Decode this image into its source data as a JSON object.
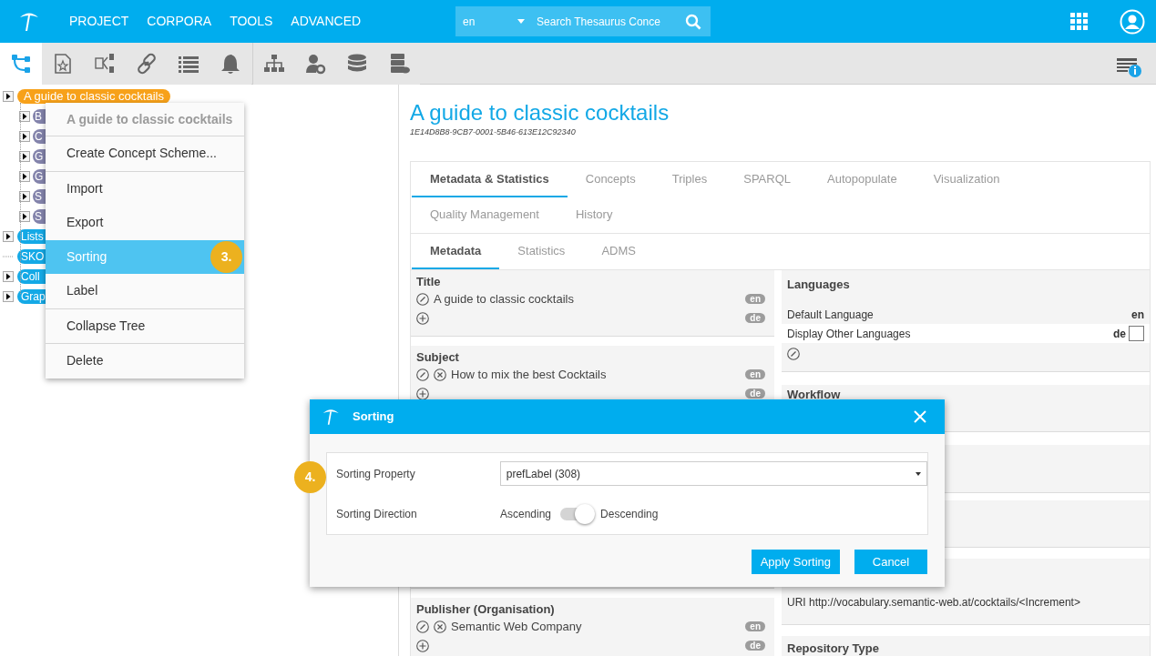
{
  "header": {
    "nav": [
      "PROJECT",
      "CORPORA",
      "TOOLS",
      "ADVANCED"
    ],
    "search": {
      "language": "en",
      "placeholder": "Search Thesaurus Conce"
    }
  },
  "toolbar": {
    "tools": [
      {
        "selected": true
      },
      {
        "selected": false
      },
      {
        "selected": false
      },
      {
        "selected": false
      },
      {
        "selected": false
      },
      {
        "selected": false
      },
      {
        "selected": false
      },
      {
        "selected": false
      },
      {
        "selected": false
      },
      {
        "selected": false
      }
    ]
  },
  "tree": [
    {
      "label": "A guide to classic cocktails",
      "kind": "scheme",
      "expandable": true,
      "children": [
        {
          "label": "B",
          "kind": "concept",
          "expandable": true
        },
        {
          "label": "C",
          "kind": "concept",
          "expandable": true
        },
        {
          "label": "G",
          "kind": "concept",
          "expandable": true
        },
        {
          "label": "G",
          "kind": "concept",
          "expandable": true
        },
        {
          "label": "S",
          "kind": "concept",
          "expandable": true
        },
        {
          "label": "S",
          "kind": "concept",
          "expandable": true
        }
      ]
    },
    {
      "label": "Lists",
      "kind": "folder",
      "expandable": true
    },
    {
      "label": "SKO",
      "kind": "folder",
      "expandable": false
    },
    {
      "label": "Coll",
      "kind": "folder",
      "expandable": true
    },
    {
      "label": "Grap",
      "kind": "folder",
      "expandable": true
    }
  ],
  "context_menu": {
    "title": "A guide to classic cocktails",
    "step_badge": "3.",
    "groups": [
      [
        {
          "label": "Create Concept Scheme...",
          "selected": false
        }
      ],
      [
        {
          "label": "Import",
          "selected": false
        },
        {
          "label": "Export",
          "selected": false
        },
        {
          "label": "Sorting",
          "selected": true
        },
        {
          "label": "Label",
          "selected": false
        }
      ],
      [
        {
          "label": "Collapse Tree",
          "selected": false
        }
      ],
      [
        {
          "label": "Delete",
          "selected": false
        }
      ]
    ]
  },
  "scheme": {
    "title": "A guide to classic cocktails",
    "id": "1E14D8B8-9CB7-0001-5B46-613E12C92340",
    "tabs": [
      [
        {
          "label": "Metadata & Statistics",
          "selected": true
        },
        {
          "label": "Concepts",
          "selected": false
        },
        {
          "label": "Triples",
          "selected": false
        },
        {
          "label": "SPARQL",
          "selected": false
        },
        {
          "label": "Autopopulate",
          "selected": false
        },
        {
          "label": "Visualization",
          "selected": false
        }
      ],
      [
        {
          "label": "Quality Management",
          "selected": false
        },
        {
          "label": "History",
          "selected": false
        }
      ]
    ],
    "subtabs": [
      {
        "label": "Metadata",
        "selected": true
      },
      {
        "label": "Statistics",
        "selected": false
      },
      {
        "label": "ADMS",
        "selected": false
      }
    ]
  },
  "metadata_left": [
    {
      "heading": "Title",
      "values": [
        {
          "text": "A guide to classic cocktails",
          "lang": "en",
          "removable": false
        }
      ],
      "add_lang": "de"
    },
    {
      "heading": "Subject",
      "values": [
        {
          "text": "How to mix the best Cocktails",
          "lang": "en",
          "removable": true
        }
      ],
      "add_lang": "de"
    },
    {
      "heading": "Publisher (Organisation)",
      "values": [
        {
          "text": "Semantic Web Company",
          "lang": "en",
          "removable": true
        }
      ],
      "add_lang": "de"
    }
  ],
  "metadata_right": {
    "languages": {
      "heading": "Languages",
      "default_label": "Default Language",
      "default_value": "en",
      "other_label": "Display Other Languages",
      "other_value": "de",
      "other_checked": false
    },
    "workflow": {
      "heading": "Workflow"
    },
    "uri": {
      "text": "URI http://vocabulary.semantic-web.at/cocktails/<Increment>"
    },
    "repository": {
      "heading": "Repository Type"
    }
  },
  "dialog": {
    "title": "Sorting",
    "step_badge": "4.",
    "property_label": "Sorting Property",
    "property_value": "prefLabel (308)",
    "direction_label": "Sorting Direction",
    "direction_off": "Ascending",
    "direction_on": "Descending",
    "descending": true,
    "buttons": [
      "Apply Sorting",
      "Cancel"
    ]
  }
}
